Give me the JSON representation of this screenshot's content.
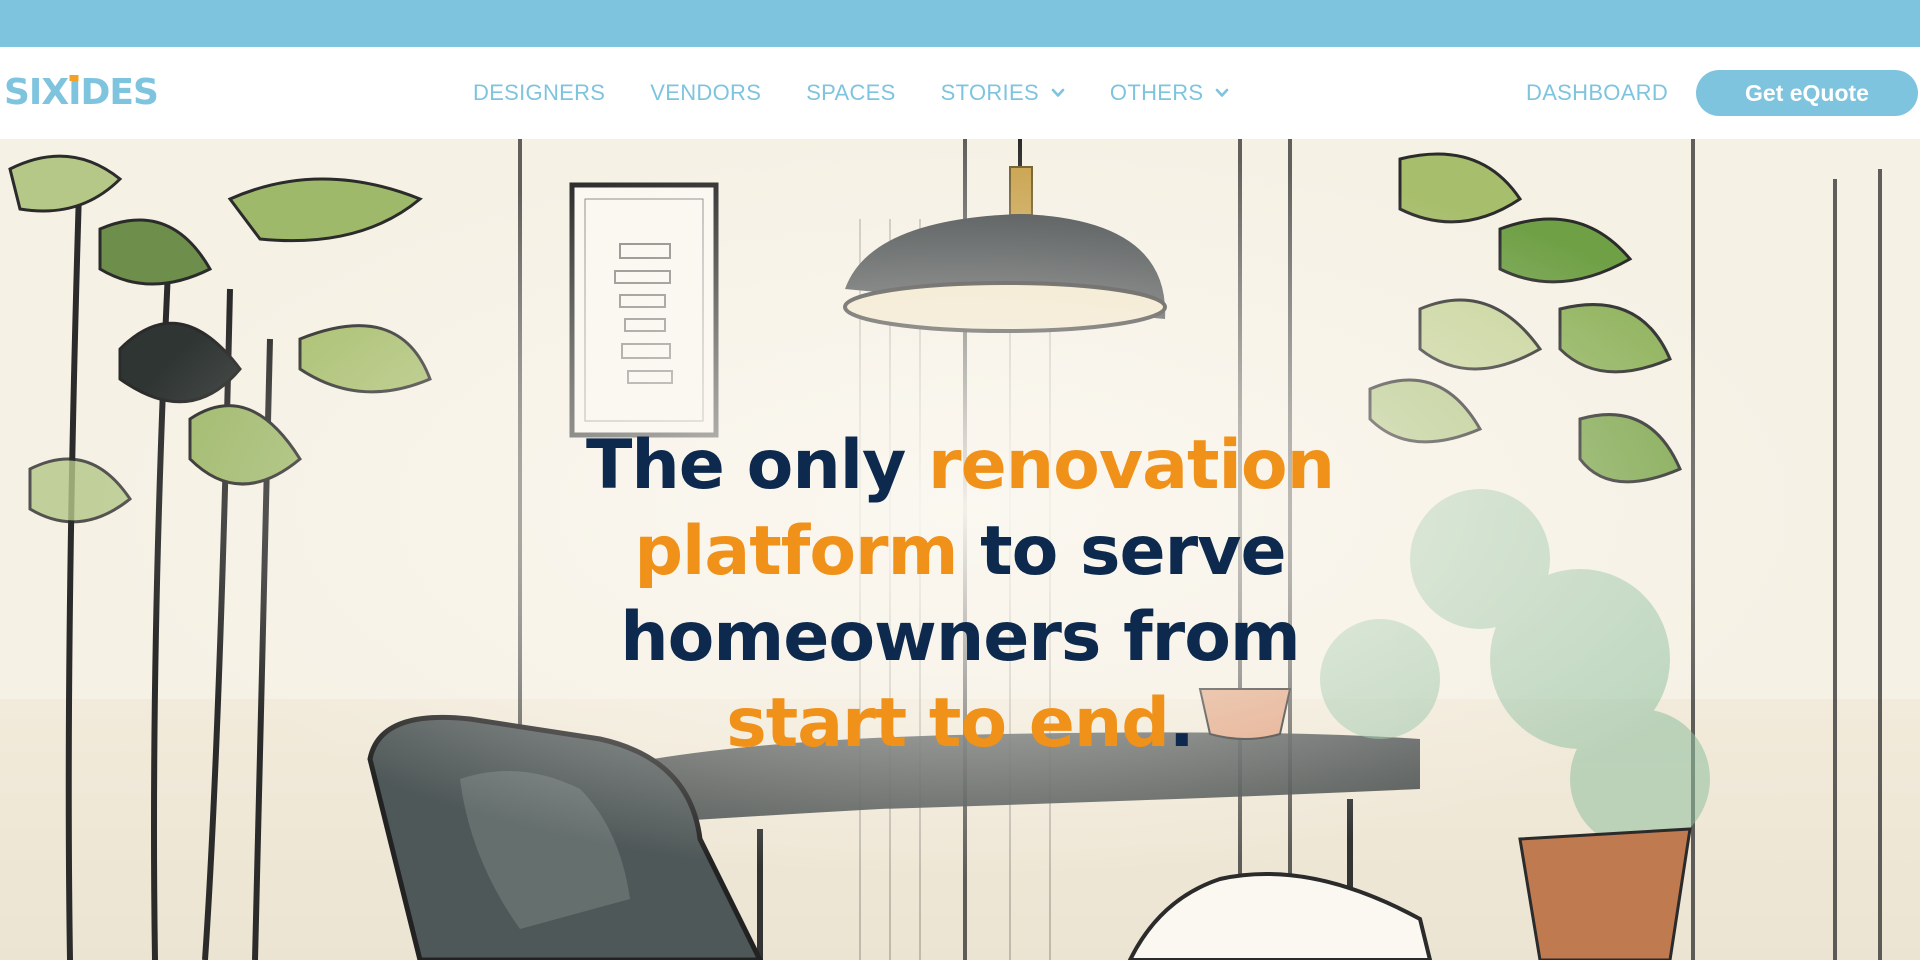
{
  "brand": {
    "logo_before": "SIX",
    "logo_i": "I",
    "logo_after": "DES",
    "colors": {
      "primary": "#7fc4df",
      "accent": "#f0921a",
      "navy": "#0d2a4e"
    }
  },
  "nav": {
    "items": [
      {
        "label": "DESIGNERS",
        "dropdown": false
      },
      {
        "label": "VENDORS",
        "dropdown": false
      },
      {
        "label": "SPACES",
        "dropdown": false
      },
      {
        "label": "STORIES",
        "dropdown": true,
        "icon": "chevron-down-icon"
      },
      {
        "label": "OTHERS",
        "dropdown": true,
        "icon": "chevron-down-icon"
      }
    ],
    "dashboard": "DASHBOARD",
    "cta": "Get eQuote"
  },
  "hero": {
    "line1_a": "The only ",
    "line1_b": "renovation",
    "line2_a": "platform",
    "line2_b": " to serve",
    "line3": "homeowners from",
    "line4_a": "start to end",
    "line4_b": "."
  }
}
